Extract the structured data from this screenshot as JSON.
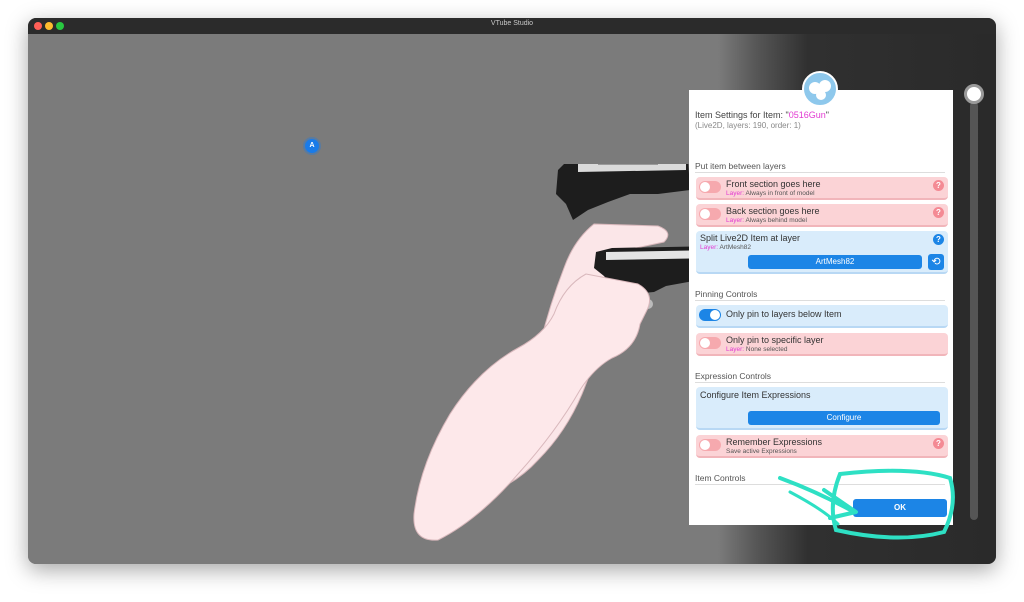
{
  "window": {
    "title": "VTube Studio"
  },
  "scene": {
    "marker_label": "A"
  },
  "panel": {
    "title_prefix": "Item Settings for Item: \"",
    "item_name": "0516Gun",
    "title_suffix": "\"",
    "subtitle": "(Live2D, layers: 190, order: 1)",
    "sections": {
      "layers": "Put item between layers",
      "pinning": "Pinning Controls",
      "expression": "Expression Controls",
      "item": "Item Controls"
    },
    "layer_key": "Layer:",
    "front": {
      "label": "Front section goes here",
      "sub": " Always in front of model",
      "enabled": false
    },
    "back": {
      "label": "Back section goes here",
      "sub": " Always behind model",
      "enabled": false
    },
    "split": {
      "label": "Split Live2D Item at layer",
      "sub": " ArtMesh82",
      "button": "ArtMesh82"
    },
    "pin_below": {
      "label": "Only pin to layers below Item",
      "enabled": true
    },
    "pin_specific": {
      "label": "Only pin to specific layer",
      "sub": " None selected",
      "enabled": false
    },
    "configure": {
      "label": "Configure Item Expressions",
      "button": "Configure"
    },
    "remember": {
      "label": "Remember Expressions",
      "sub": "Save active Expressions",
      "enabled": false
    },
    "ok_button": "OK",
    "help_glyph": "?",
    "reset_glyph": "⟲"
  },
  "colors": {
    "accent": "#1c85e6",
    "pink_row": "#fbd3d6",
    "blue_row": "#d9ecfb",
    "highlight": "#2ee0c4",
    "item_name": "#e23ad2"
  }
}
